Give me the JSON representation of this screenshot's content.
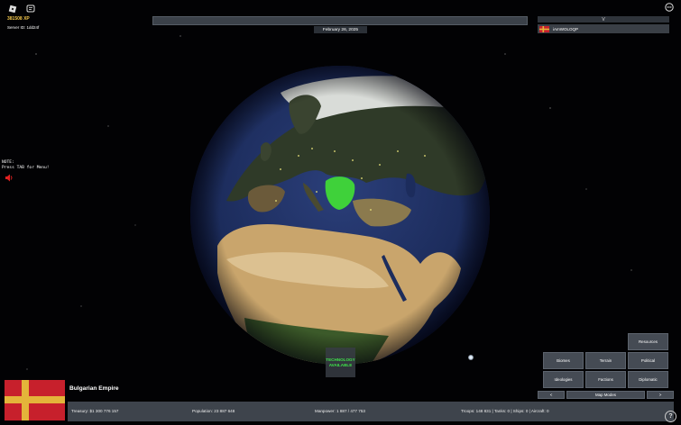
{
  "hud": {
    "xp": "381508 XP",
    "server": "Server ID: 1dd24f"
  },
  "date": "February 26, 2025",
  "players": {
    "header": "V",
    "items": [
      {
        "name": "iAmWOLOQP"
      }
    ]
  },
  "note": {
    "line1": "NOTE:",
    "line2": "Press TAB for Menu!"
  },
  "technology": {
    "line1": "TECHNOLOGY",
    "line2": "AVAILABLE"
  },
  "map_modes": {
    "resources": "Resources",
    "biomes": "Biomes",
    "terrain": "Terrain",
    "political": "Political",
    "ideologies": "Ideologies",
    "factions": "Factions",
    "diplomatic": "Diplomatic",
    "prev": "<",
    "label": "Map Modes",
    "next": ">"
  },
  "country": {
    "name": "Bulgarian Empire"
  },
  "stats": {
    "treasury": "Treasury:  $1 300 776 157",
    "population": "Population: 23 887 648",
    "manpower": "Manpower:  1 887  /  477 753",
    "military": "Troops: 148 831  |  Tanks: 0  |  Ships: 0  |  Aircraft: 0"
  },
  "help": "?",
  "colors": {
    "xp": "#f2c64a",
    "tech": "#3fe24a",
    "flag_red": "#c7202c",
    "flag_gold": "#e4b43a",
    "bulgaria_highlight": "#3fd13a"
  }
}
